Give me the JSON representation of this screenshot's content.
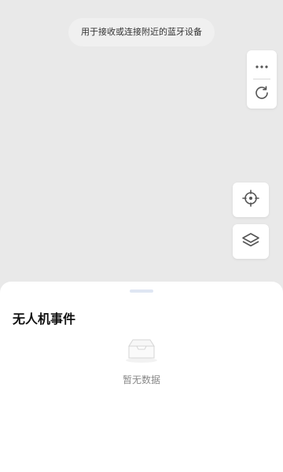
{
  "toast": {
    "message": "用于接收或连接附近的蓝牙设备"
  },
  "map_controls": {
    "more_icon": "more-horizontal-icon",
    "refresh_icon": "refresh-icon",
    "locate_icon": "crosshair-locate-icon",
    "layers_icon": "layers-icon"
  },
  "bottom_sheet": {
    "title": "无人机事件",
    "empty_text": "暂无数据",
    "empty_icon": "empty-inbox-icon"
  },
  "colors": {
    "map_background": "#e9e9e9",
    "sheet_background": "#ffffff",
    "handle": "#dfe6f3",
    "icon": "#555555"
  }
}
